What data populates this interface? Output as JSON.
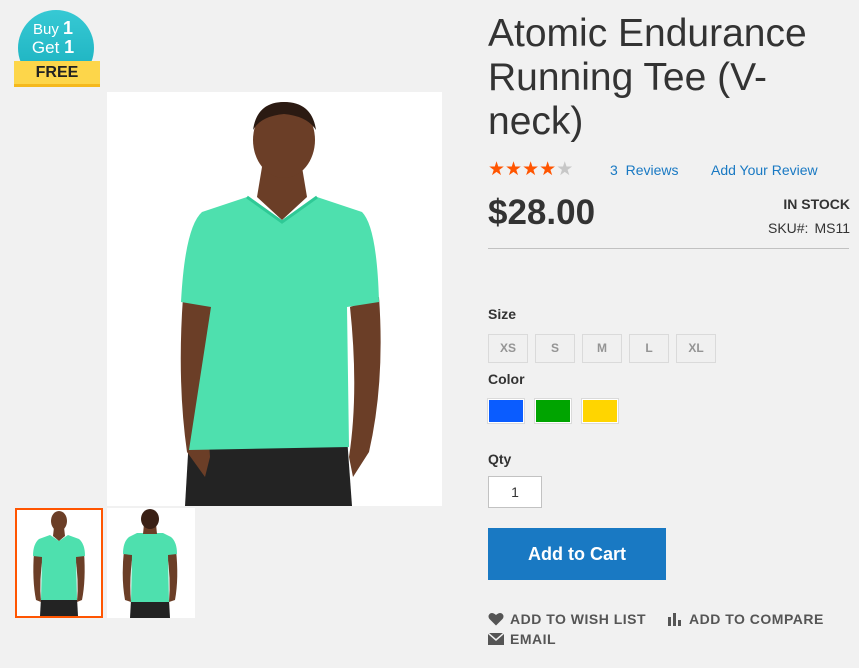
{
  "badge": {
    "buy": "Buy",
    "buy_n": "1",
    "get": "Get",
    "get_n": "1",
    "ribbon": "FREE"
  },
  "product": {
    "title": "Atomic Endurance Running Tee (V-neck)",
    "rating_stars": 4,
    "rating_max": 5,
    "reviews_count": "3",
    "reviews_label": "Reviews",
    "add_review": "Add Your Review",
    "price": "$28.00",
    "stock": "IN STOCK",
    "sku_label": "SKU#:",
    "sku_value": "MS11"
  },
  "options": {
    "size_label": "Size",
    "sizes": [
      "XS",
      "S",
      "M",
      "L",
      "XL"
    ],
    "color_label": "Color",
    "colors": [
      "#0a5cff",
      "#00a400",
      "#ffd500"
    ]
  },
  "qty": {
    "label": "Qty",
    "value": "1"
  },
  "actions": {
    "add_to_cart": "Add to Cart",
    "wish_list": "ADD TO WISH LIST",
    "compare": "ADD TO COMPARE",
    "email": "EMAIL"
  },
  "colors": {
    "accent": "#1979c3",
    "star": "#ff5501",
    "shirt": "#4ee0ae",
    "badge": "#17aebd",
    "ribbon": "#fdd64a"
  }
}
